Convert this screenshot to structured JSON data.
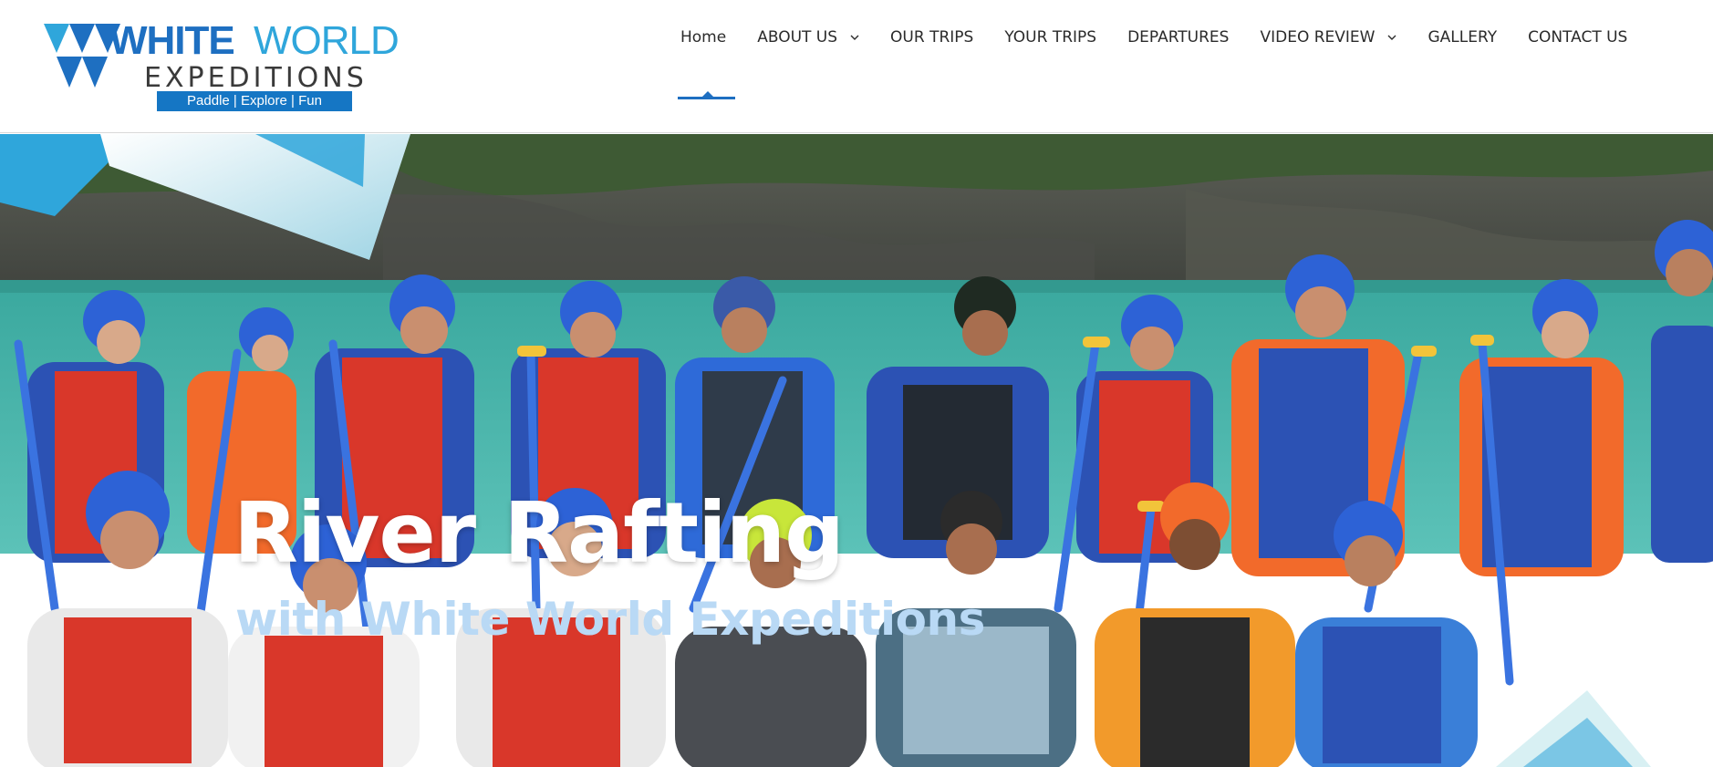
{
  "brand": {
    "name_part1": "WHITE",
    "name_part2": "WORLD",
    "subtitle": "EXPEDITIONS",
    "tagline": "Paddle | Explore | Fun",
    "colors": {
      "primary": "#1e6fc1",
      "secondary": "#2fa6db",
      "tagline_bg": "#1576c4"
    }
  },
  "nav": {
    "items": [
      {
        "label": "Home",
        "active": true,
        "dropdown": false
      },
      {
        "label": "ABOUT US",
        "active": false,
        "dropdown": true
      },
      {
        "label": "OUR TRIPS",
        "active": false,
        "dropdown": false
      },
      {
        "label": "YOUR TRIPS",
        "active": false,
        "dropdown": false
      },
      {
        "label": "DEPARTURES",
        "active": false,
        "dropdown": false
      },
      {
        "label": "VIDEO REVIEW",
        "active": false,
        "dropdown": true
      },
      {
        "label": "GALLERY",
        "active": false,
        "dropdown": false
      },
      {
        "label": "CONTACT US",
        "active": false,
        "dropdown": false
      }
    ],
    "dropdown_icon": "chevron-down-icon"
  },
  "hero": {
    "title": "River Rafting",
    "subtitle": "with White World Expeditions",
    "colors": {
      "title": "#ffffff",
      "subtitle": "#b9d9f5",
      "water": "#3fb3a8",
      "accent": "#1e9bd7"
    }
  }
}
